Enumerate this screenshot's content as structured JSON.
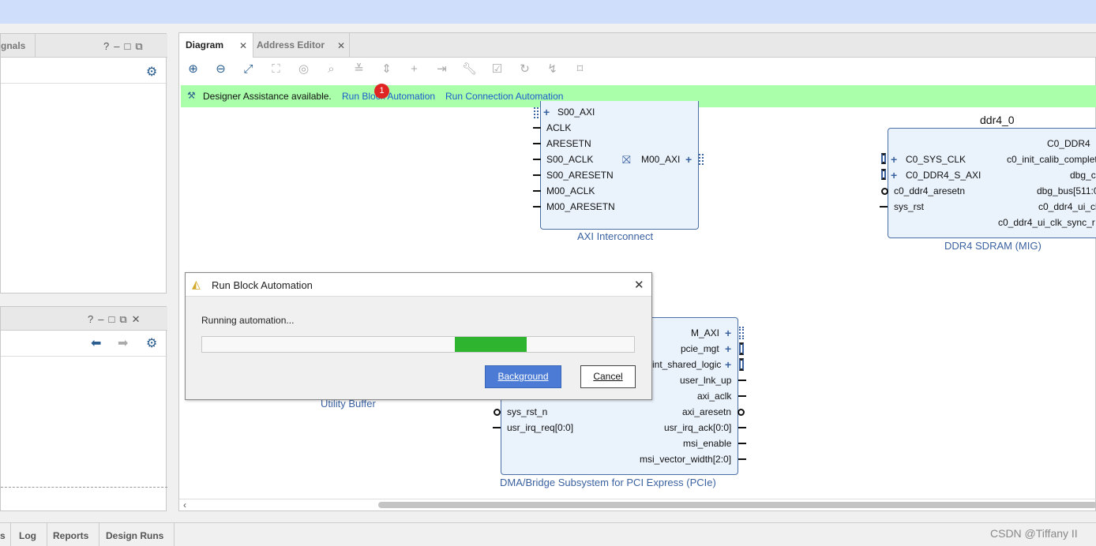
{
  "left_panel_top": {
    "tab_label": "gnals",
    "icons": [
      "question-icon",
      "minimize-icon",
      "maximize-icon",
      "float-icon",
      "gear-icon"
    ]
  },
  "left_panel_bottom": {
    "icons": [
      "question-icon",
      "minimize-icon",
      "maximize-icon",
      "float-icon",
      "close-icon",
      "back-arrow-icon",
      "forward-arrow-icon",
      "gear-icon"
    ]
  },
  "tabs": [
    {
      "label": "Diagram"
    },
    {
      "label": "Address Editor"
    }
  ],
  "toolbar": {
    "icons": [
      "zoom-in-icon",
      "zoom-out-icon",
      "fit-view-icon",
      "fit-selection-icon",
      "auto-connect-icon",
      "search-icon",
      "collapse-icon",
      "expand-icon",
      "add-ip-icon",
      "make-external-icon",
      "properties-icon",
      "validate-icon",
      "regenerate-icon",
      "optimize-routing-icon",
      "pin-icon"
    ]
  },
  "assist": {
    "text": "Designer Assistance available.",
    "link_block": "Run Block Automation",
    "link_conn": "Run Connection Automation",
    "badge": "1"
  },
  "axi_interconnect": {
    "title": "AXI Interconnect",
    "left_ports": [
      "S00_AXI",
      "ACLK",
      "ARESETN",
      "S00_ACLK",
      "S00_ARESETN",
      "M00_ACLK",
      "M00_ARESETN"
    ],
    "right_port": "M00_AXI"
  },
  "ddr4": {
    "instance": "ddr4_0",
    "title": "DDR4 SDRAM (MIG)",
    "left_ports": [
      "C0_SYS_CLK",
      "C0_DDR4_S_AXI",
      "c0_ddr4_aresetn",
      "sys_rst"
    ],
    "right_ports": [
      "C0_DDR4",
      "c0_init_calib_complet",
      "dbg_c",
      "dbg_bus[511:0",
      "c0_ddr4_ui_cl",
      "c0_ddr4_ui_clk_sync_r"
    ]
  },
  "xdma": {
    "title": "DMA/Bridge Subsystem for PCI Express (PCIe)",
    "left_ports": [
      "sys_rst_n",
      "usr_irq_req[0:0]"
    ],
    "right_ports": [
      "M_AXI",
      "pcie_mgt",
      "int_shared_logic",
      "user_lnk_up",
      "axi_aclk",
      "axi_aresetn",
      "usr_irq_ack[0:0]",
      "msi_enable",
      "msi_vector_width[2:0]"
    ]
  },
  "utility_buffer": {
    "title": "Utility Buffer"
  },
  "dialog": {
    "title": "Run Block Automation",
    "message": "Running automation...",
    "progress_fraction": 0.2,
    "background_button": "Background",
    "cancel_button": "Cancel"
  },
  "status_tabs": [
    "s",
    "Log",
    "Reports",
    "Design Runs"
  ],
  "watermark": "CSDN @Tiffany II"
}
